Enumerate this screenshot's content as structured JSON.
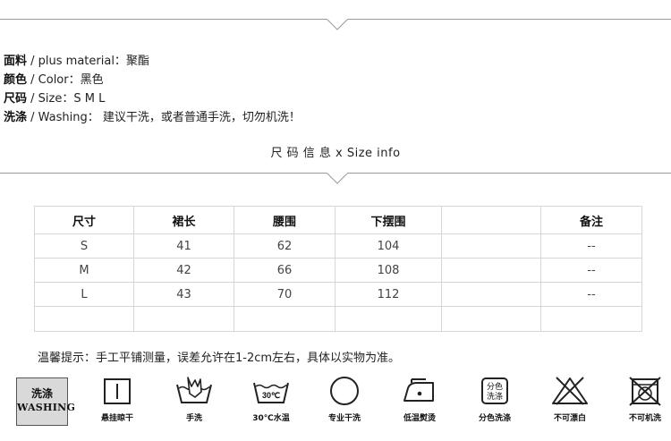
{
  "specs": {
    "material": {
      "label": "面料",
      "sep": " / plus material：",
      "value": "聚酯"
    },
    "color": {
      "label": "颜色",
      "sep": " / Color：",
      "value": "黑色"
    },
    "size": {
      "label": "尺码",
      "sep": " / Size：",
      "value": "S  M  L"
    },
    "washing": {
      "label": "洗涤",
      "sep": " / Washing：",
      "value": " 建议干洗，或者普通手洗，切勿机洗！"
    }
  },
  "size_info_title": "尺 码 信 息 x Size info",
  "size_table": {
    "headers": [
      "尺寸",
      "裙长",
      "腰围",
      "下摆围",
      "",
      "备注"
    ],
    "rows": [
      [
        "S",
        "41",
        "62",
        "104",
        "",
        "--"
      ],
      [
        "M",
        "42",
        "66",
        "108",
        "",
        "--"
      ],
      [
        "L",
        "43",
        "70",
        "112",
        "",
        "--"
      ],
      [
        "",
        "",
        "",
        "",
        "",
        ""
      ]
    ]
  },
  "note": "温馨提示：手工平铺测量，误差允许在1-2cm左右，具体以实物为准。",
  "washing_badge": {
    "line1": "洗涤",
    "line2": "WASHING"
  },
  "care_icons": [
    {
      "icon": "hang-dry-icon",
      "label": "悬挂晾干"
    },
    {
      "icon": "hand-wash-icon",
      "label": "手洗"
    },
    {
      "icon": "wash-30c-icon",
      "label": "30℃水温",
      "temp": "30℃"
    },
    {
      "icon": "professional-dry-clean-icon",
      "label": "专业干洗"
    },
    {
      "icon": "low-temp-iron-icon",
      "label": "低温熨烫"
    },
    {
      "icon": "separate-color-wash-icon",
      "label": "分色洗涤",
      "text1": "分色",
      "text2": "洗涤"
    },
    {
      "icon": "no-bleach-icon",
      "label": "不可漂白"
    },
    {
      "icon": "no-machine-wash-icon",
      "label": "不可机洗"
    }
  ]
}
